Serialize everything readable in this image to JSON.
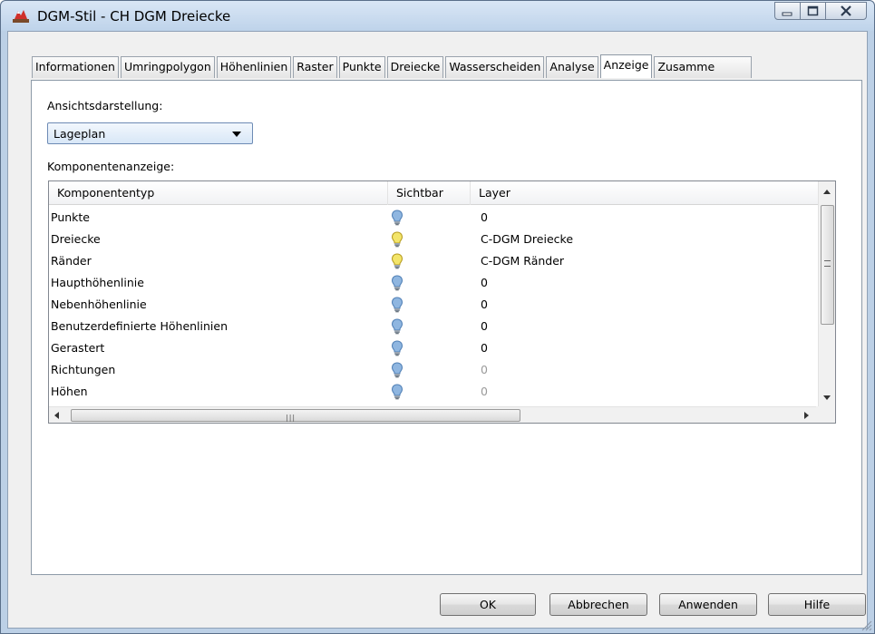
{
  "window": {
    "title": "DGM-Stil - CH DGM Dreiecke"
  },
  "tabs": [
    {
      "label": "Informationen"
    },
    {
      "label": "Umringpolygon"
    },
    {
      "label": "Höhenlinien"
    },
    {
      "label": "Raster"
    },
    {
      "label": "Punkte"
    },
    {
      "label": "Dreiecke"
    },
    {
      "label": "Wasserscheiden"
    },
    {
      "label": "Analyse"
    },
    {
      "label": "Anzeige",
      "active": true
    },
    {
      "label": "Zusamme"
    }
  ],
  "view": {
    "label": "Ansichtsdarstellung:",
    "selected": "Lageplan"
  },
  "components": {
    "label": "Komponentenanzeige:",
    "columns": [
      "Komponententyp",
      "Sichtbar",
      "Layer"
    ],
    "rows": [
      {
        "type": "Punkte",
        "visible": false,
        "layer": "0"
      },
      {
        "type": "Dreiecke",
        "visible": true,
        "layer": "C-DGM Dreiecke"
      },
      {
        "type": "Ränder",
        "visible": true,
        "layer": "C-DGM Ränder"
      },
      {
        "type": "Haupthöhenlinie",
        "visible": false,
        "layer": "0"
      },
      {
        "type": "Nebenhöhenlinie",
        "visible": false,
        "layer": "0"
      },
      {
        "type": "Benutzerdefinierte Höhenlinien",
        "visible": false,
        "layer": "0"
      },
      {
        "type": "Gerastert",
        "visible": false,
        "layer": "0"
      },
      {
        "type": "Richtungen",
        "visible": false,
        "layer": "0",
        "dim": true
      },
      {
        "type": "Höhen",
        "visible": false,
        "layer": "0",
        "dim": true
      }
    ]
  },
  "icons": {
    "visible_on": "lightbulb-on-icon",
    "visible_off": "lightbulb-off-icon",
    "colors": {
      "on": "#f3e56a",
      "off": "#8fb6e0"
    }
  },
  "buttons": {
    "ok": "OK",
    "cancel": "Abbrechen",
    "apply": "Anwenden",
    "help": "Hilfe"
  }
}
